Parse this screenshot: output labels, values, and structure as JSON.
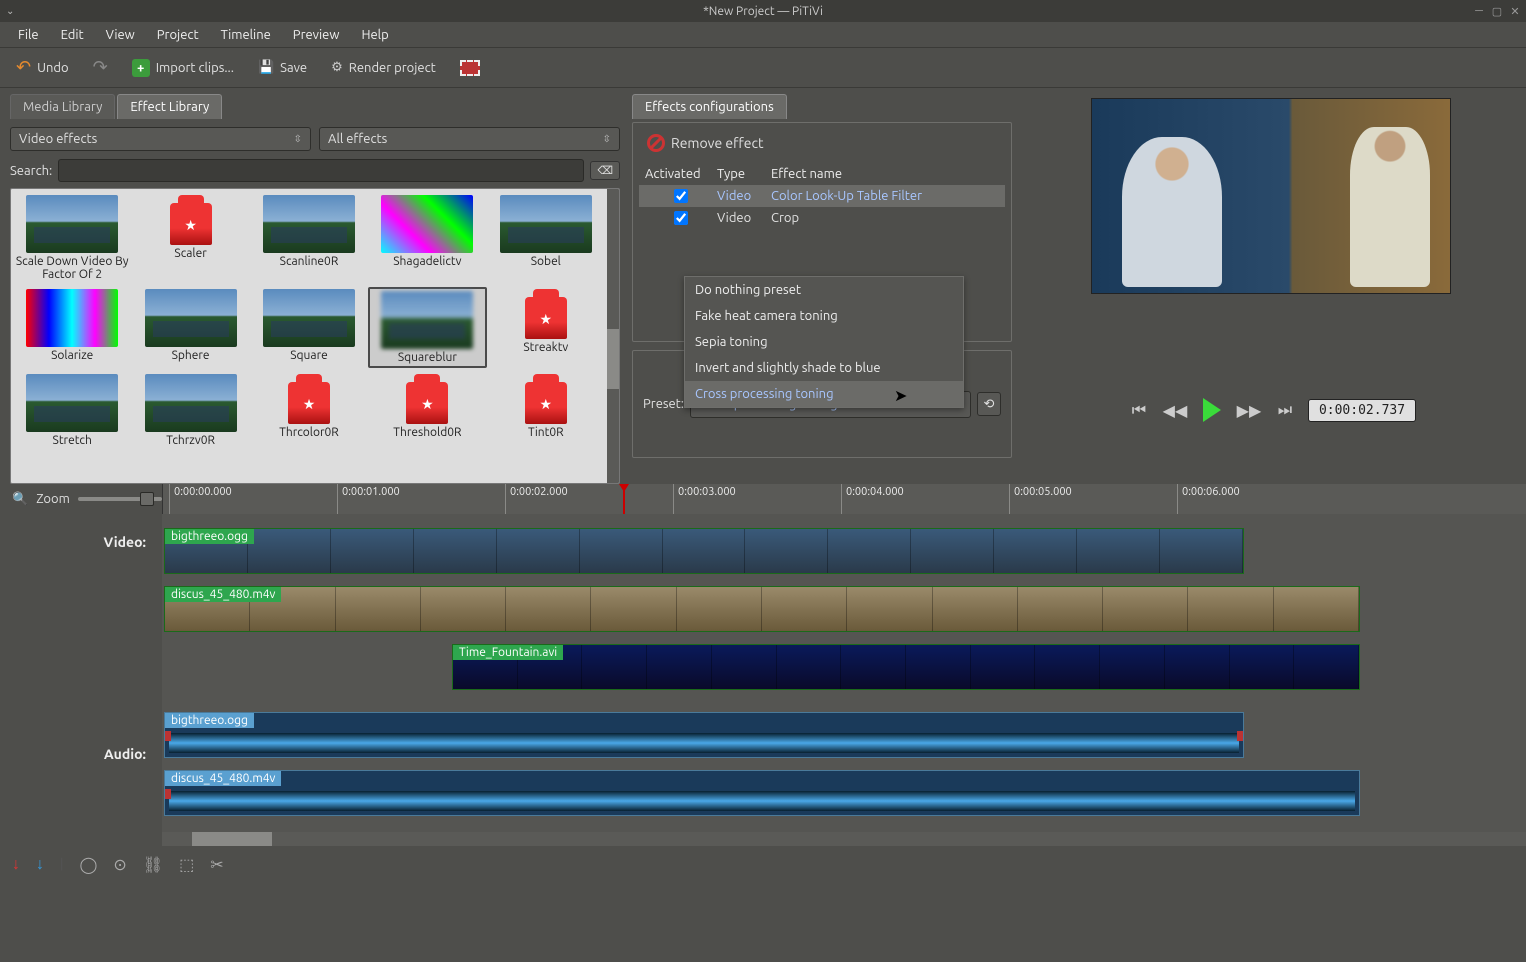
{
  "title": "*New Project — PiTiVi",
  "menus": {
    "file": "File",
    "edit": "Edit",
    "view": "View",
    "project": "Project",
    "timeline": "Timeline",
    "preview": "Preview",
    "help": "Help"
  },
  "toolbar": {
    "undo": "Undo",
    "import": "Import clips...",
    "save": "Save",
    "render": "Render project"
  },
  "tabs": {
    "media": "Media Library",
    "effects": "Effect Library"
  },
  "filter": {
    "category": "Video effects",
    "subset": "All effects"
  },
  "search": {
    "label": "Search:",
    "value": ""
  },
  "effects_list": [
    {
      "name": "Scale Down Video By Factor Of 2",
      "kind": "sky"
    },
    {
      "name": "Scaler",
      "kind": "box"
    },
    {
      "name": "Scanline0R",
      "kind": "sky"
    },
    {
      "name": "Shagadelictv",
      "kind": "disco"
    },
    {
      "name": "Sobel",
      "kind": "sky"
    },
    {
      "name": "Solarize",
      "kind": "solar"
    },
    {
      "name": "Sphere",
      "kind": "sky"
    },
    {
      "name": "Square",
      "kind": "sky"
    },
    {
      "name": "Squareblur",
      "kind": "skyblur",
      "selected": true
    },
    {
      "name": "Streaktv",
      "kind": "box"
    },
    {
      "name": "Stretch",
      "kind": "sky",
      "bottom": true
    },
    {
      "name": "Tchrzv0R",
      "kind": "sky",
      "bottom": true
    },
    {
      "name": "Thrcolor0R",
      "kind": "box",
      "bottom": true
    },
    {
      "name": "Threshold0R",
      "kind": "box",
      "bottom": true
    },
    {
      "name": "Tint0R",
      "kind": "box",
      "bottom": true
    }
  ],
  "cfg": {
    "tab": "Effects configurations",
    "remove": "Remove effect",
    "colhead": {
      "activated": "Activated",
      "type": "Type",
      "name": "Effect name"
    },
    "rows": [
      {
        "activated": true,
        "type": "Video",
        "name": "Color Look-Up Table Filter",
        "selected": true
      },
      {
        "activated": true,
        "type": "Video",
        "name": "Crop"
      }
    ],
    "preset_label": "Preset:",
    "preset_value": "Cross processing toning",
    "preset_options": [
      "Do nothing preset",
      "Fake heat camera toning",
      "Sepia toning",
      "Invert and slightly shade to blue",
      "Cross processing toning"
    ]
  },
  "playback": {
    "timecode": "0:00:02.737"
  },
  "timeline": {
    "zoom_label": "Zoom",
    "ticks": [
      "0:00:00.000",
      "0:00:01.000",
      "0:00:02.000",
      "0:00:03.000",
      "0:00:04.000",
      "0:00:05.000",
      "0:00:06.000"
    ],
    "video_label": "Video:",
    "audio_label": "Audio:",
    "clips": {
      "v1": "bigthreeo.ogg",
      "v2": "discus_45_480.m4v",
      "v3": "Time_Fountain.avi",
      "a1": "bigthreeo.ogg",
      "a2": "discus_45_480.m4v"
    }
  }
}
